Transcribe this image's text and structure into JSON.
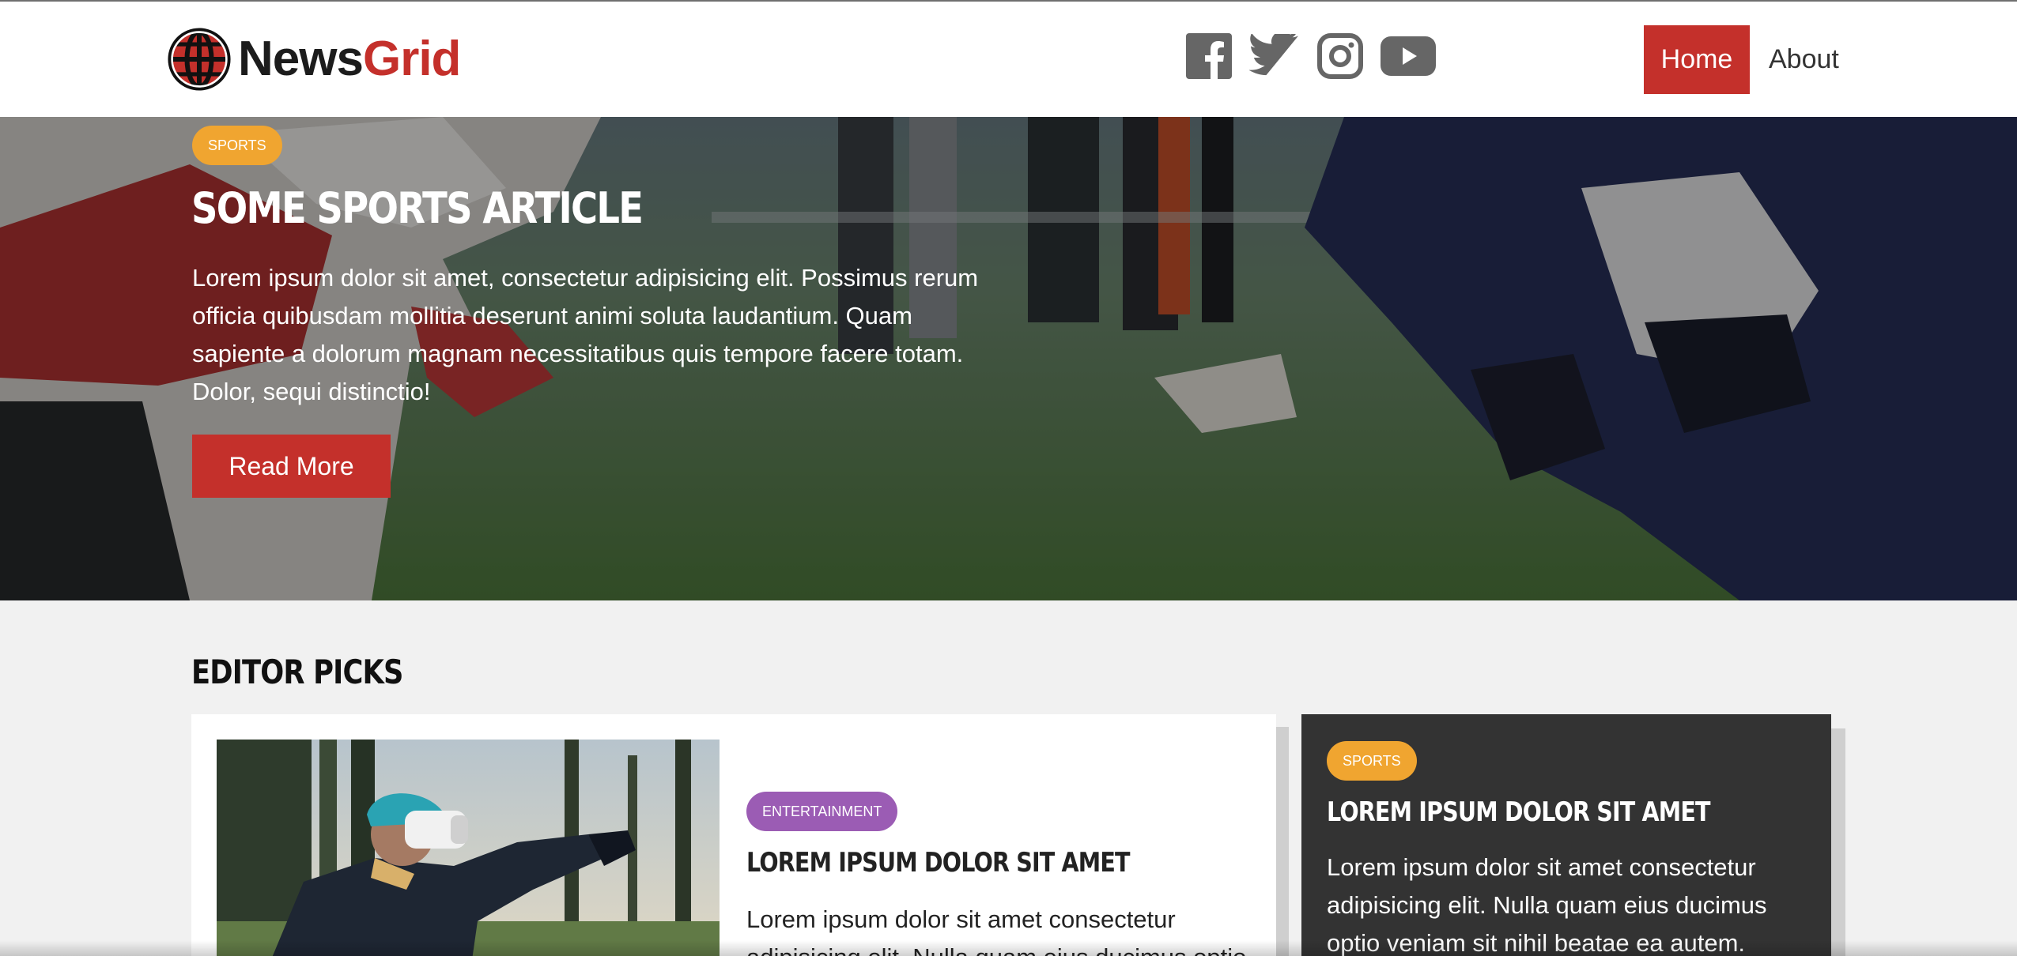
{
  "brand": {
    "name_part1": "News",
    "name_part2": "Grid",
    "accent": "#c4302b"
  },
  "socials": [
    {
      "icon": "facebook-icon"
    },
    {
      "icon": "twitter-icon"
    },
    {
      "icon": "instagram-icon"
    },
    {
      "icon": "youtube-icon"
    }
  ],
  "nav": {
    "home": "Home",
    "about": "About"
  },
  "hero": {
    "category": "Sports",
    "title": "Some Sports Article",
    "text": "Lorem ipsum dolor sit amet, consectetur adipisicing elit. Possimus rerum officia quibusdam mollitia deserunt animi soluta laudantium. Quam sapiente a dolorum magnam necessitatibus quis tempore facere totam. Dolor, sequi distinctio!",
    "button": "Read More"
  },
  "editor_picks": {
    "title": "Editor Picks",
    "cards": [
      {
        "category": "Entertainment",
        "title": "Lorem ipsum dolor sit amet",
        "text": "Lorem ipsum dolor sit amet consectetur adipisicing elit. Nulla quam eius ducimus optio"
      },
      {
        "category": "Sports",
        "title": "Lorem ipsum dolor sit amet",
        "text": "Lorem ipsum dolor sit amet consectetur adipisicing elit. Nulla quam eius ducimus optio veniam sit nihil beatae ea autem."
      }
    ]
  },
  "colors": {
    "sports": "#f0a530",
    "entertainment": "#9b5cb4",
    "dark_card": "#333333"
  }
}
